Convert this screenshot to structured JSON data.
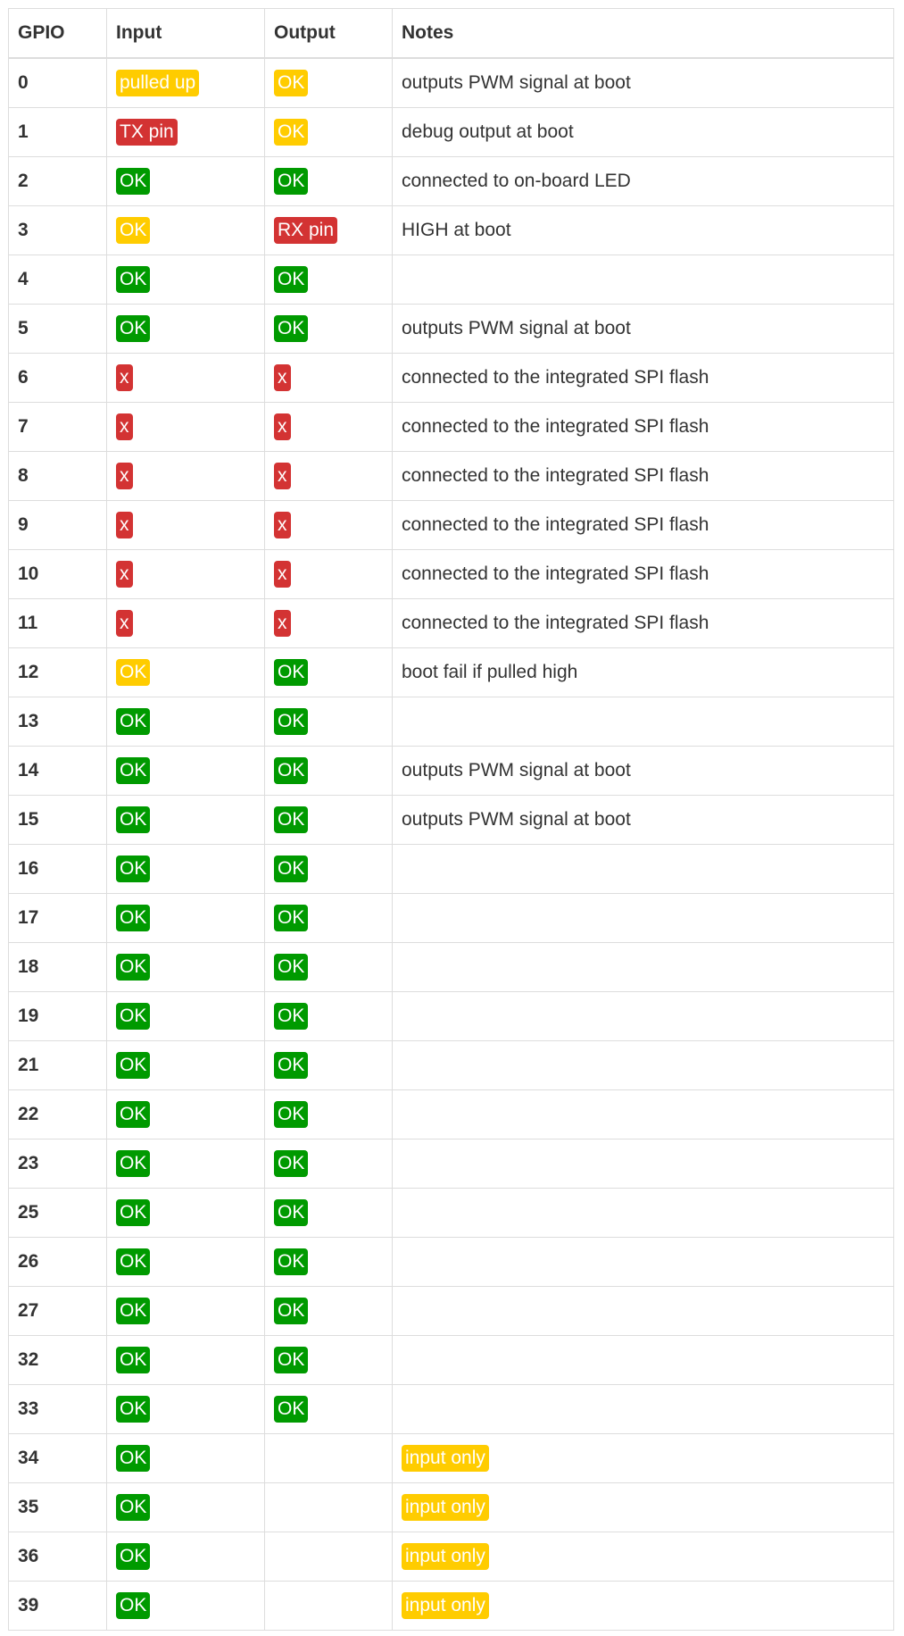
{
  "colors": {
    "green": "#009a00",
    "yellow": "#ffcc00",
    "red": "#d33333"
  },
  "headers": [
    "GPIO",
    "Input",
    "Output",
    "Notes"
  ],
  "rows": [
    {
      "gpio": "0",
      "input": {
        "text": "pulled up",
        "color": "yellow"
      },
      "output": {
        "text": "OK",
        "color": "yellow"
      },
      "notes": "outputs PWM signal at boot"
    },
    {
      "gpio": "1",
      "input": {
        "text": "TX pin",
        "color": "red"
      },
      "output": {
        "text": "OK",
        "color": "yellow"
      },
      "notes": "debug output at boot"
    },
    {
      "gpio": "2",
      "input": {
        "text": "OK",
        "color": "green"
      },
      "output": {
        "text": "OK",
        "color": "green"
      },
      "notes": "connected to on-board LED"
    },
    {
      "gpio": "3",
      "input": {
        "text": "OK",
        "color": "yellow"
      },
      "output": {
        "text": "RX pin",
        "color": "red"
      },
      "notes": "HIGH at boot"
    },
    {
      "gpio": "4",
      "input": {
        "text": "OK",
        "color": "green"
      },
      "output": {
        "text": "OK",
        "color": "green"
      },
      "notes": ""
    },
    {
      "gpio": "5",
      "input": {
        "text": "OK",
        "color": "green"
      },
      "output": {
        "text": "OK",
        "color": "green"
      },
      "notes": "outputs PWM signal at boot"
    },
    {
      "gpio": "6",
      "input": {
        "text": "x",
        "color": "red"
      },
      "output": {
        "text": "x",
        "color": "red"
      },
      "notes": "connected to the integrated SPI flash"
    },
    {
      "gpio": "7",
      "input": {
        "text": "x",
        "color": "red"
      },
      "output": {
        "text": "x",
        "color": "red"
      },
      "notes": "connected to the integrated SPI flash"
    },
    {
      "gpio": "8",
      "input": {
        "text": "x",
        "color": "red"
      },
      "output": {
        "text": "x",
        "color": "red"
      },
      "notes": "connected to the integrated SPI flash"
    },
    {
      "gpio": "9",
      "input": {
        "text": "x",
        "color": "red"
      },
      "output": {
        "text": "x",
        "color": "red"
      },
      "notes": "connected to the integrated SPI flash"
    },
    {
      "gpio": "10",
      "input": {
        "text": "x",
        "color": "red"
      },
      "output": {
        "text": "x",
        "color": "red"
      },
      "notes": "connected to the integrated SPI flash"
    },
    {
      "gpio": "11",
      "input": {
        "text": "x",
        "color": "red"
      },
      "output": {
        "text": "x",
        "color": "red"
      },
      "notes": "connected to the integrated SPI flash"
    },
    {
      "gpio": "12",
      "input": {
        "text": "OK",
        "color": "yellow"
      },
      "output": {
        "text": "OK",
        "color": "green"
      },
      "notes": "boot fail if pulled high"
    },
    {
      "gpio": "13",
      "input": {
        "text": "OK",
        "color": "green"
      },
      "output": {
        "text": "OK",
        "color": "green"
      },
      "notes": ""
    },
    {
      "gpio": "14",
      "input": {
        "text": "OK",
        "color": "green"
      },
      "output": {
        "text": "OK",
        "color": "green"
      },
      "notes": "outputs PWM signal at boot"
    },
    {
      "gpio": "15",
      "input": {
        "text": "OK",
        "color": "green"
      },
      "output": {
        "text": "OK",
        "color": "green"
      },
      "notes": "outputs PWM signal at boot"
    },
    {
      "gpio": "16",
      "input": {
        "text": "OK",
        "color": "green"
      },
      "output": {
        "text": "OK",
        "color": "green"
      },
      "notes": ""
    },
    {
      "gpio": "17",
      "input": {
        "text": "OK",
        "color": "green"
      },
      "output": {
        "text": "OK",
        "color": "green"
      },
      "notes": ""
    },
    {
      "gpio": "18",
      "input": {
        "text": "OK",
        "color": "green"
      },
      "output": {
        "text": "OK",
        "color": "green"
      },
      "notes": ""
    },
    {
      "gpio": "19",
      "input": {
        "text": "OK",
        "color": "green"
      },
      "output": {
        "text": "OK",
        "color": "green"
      },
      "notes": ""
    },
    {
      "gpio": "21",
      "input": {
        "text": "OK",
        "color": "green"
      },
      "output": {
        "text": "OK",
        "color": "green"
      },
      "notes": ""
    },
    {
      "gpio": "22",
      "input": {
        "text": "OK",
        "color": "green"
      },
      "output": {
        "text": "OK",
        "color": "green"
      },
      "notes": ""
    },
    {
      "gpio": "23",
      "input": {
        "text": "OK",
        "color": "green"
      },
      "output": {
        "text": "OK",
        "color": "green"
      },
      "notes": ""
    },
    {
      "gpio": "25",
      "input": {
        "text": "OK",
        "color": "green"
      },
      "output": {
        "text": "OK",
        "color": "green"
      },
      "notes": ""
    },
    {
      "gpio": "26",
      "input": {
        "text": "OK",
        "color": "green"
      },
      "output": {
        "text": "OK",
        "color": "green"
      },
      "notes": ""
    },
    {
      "gpio": "27",
      "input": {
        "text": "OK",
        "color": "green"
      },
      "output": {
        "text": "OK",
        "color": "green"
      },
      "notes": ""
    },
    {
      "gpio": "32",
      "input": {
        "text": "OK",
        "color": "green"
      },
      "output": {
        "text": "OK",
        "color": "green"
      },
      "notes": ""
    },
    {
      "gpio": "33",
      "input": {
        "text": "OK",
        "color": "green"
      },
      "output": {
        "text": "OK",
        "color": "green"
      },
      "notes": ""
    },
    {
      "gpio": "34",
      "input": {
        "text": "OK",
        "color": "green"
      },
      "output": null,
      "notes_badge": {
        "text": "input only",
        "color": "yellow"
      }
    },
    {
      "gpio": "35",
      "input": {
        "text": "OK",
        "color": "green"
      },
      "output": null,
      "notes_badge": {
        "text": "input only",
        "color": "yellow"
      }
    },
    {
      "gpio": "36",
      "input": {
        "text": "OK",
        "color": "green"
      },
      "output": null,
      "notes_badge": {
        "text": "input only",
        "color": "yellow"
      }
    },
    {
      "gpio": "39",
      "input": {
        "text": "OK",
        "color": "green"
      },
      "output": null,
      "notes_badge": {
        "text": "input only",
        "color": "yellow"
      }
    }
  ]
}
